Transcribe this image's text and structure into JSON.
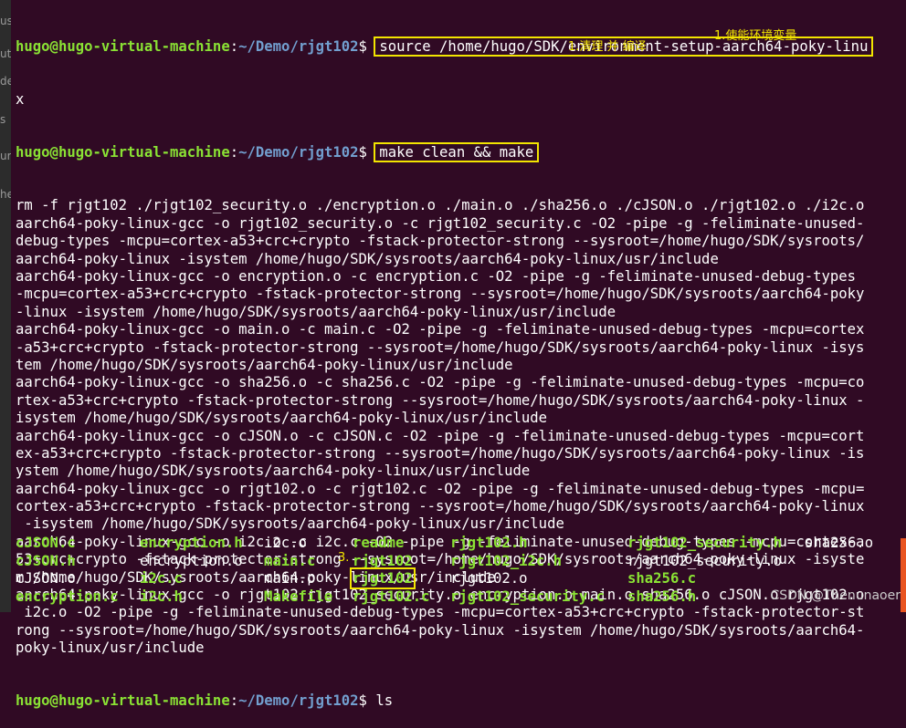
{
  "sidebar": {
    "fragments": [
      "usi",
      "ut",
      "de",
      "s",
      "ur",
      "he"
    ]
  },
  "prompt": {
    "user": "hugo@hugo-virtual-machine",
    "path": "~/Demo/rjgt102",
    "symbol": "$"
  },
  "cmd1": {
    "text": "source /home/hugo/SDK/environment-setup-aarch64-poky-linu",
    "wrap": "x"
  },
  "cmd2": {
    "text": "make clean && make"
  },
  "notes": {
    "note1": "1.使能环境变量",
    "note2": "1.清理 并 编译",
    "note3": "3."
  },
  "output": [
    "rm -f rjgt102 ./rjgt102_security.o ./encryption.o ./main.o ./sha256.o ./cJSON.o ./rjgt102.o ./i2c.o",
    "aarch64-poky-linux-gcc -o rjgt102_security.o -c rjgt102_security.c -O2 -pipe -g -feliminate-unused-",
    "debug-types -mcpu=cortex-a53+crc+crypto -fstack-protector-strong --sysroot=/home/hugo/SDK/sysroots/",
    "aarch64-poky-linux -isystem /home/hugo/SDK/sysroots/aarch64-poky-linux/usr/include",
    "aarch64-poky-linux-gcc -o encryption.o -c encryption.c -O2 -pipe -g -feliminate-unused-debug-types",
    "-mcpu=cortex-a53+crc+crypto -fstack-protector-strong --sysroot=/home/hugo/SDK/sysroots/aarch64-poky",
    "-linux -isystem /home/hugo/SDK/sysroots/aarch64-poky-linux/usr/include",
    "aarch64-poky-linux-gcc -o main.o -c main.c -O2 -pipe -g -feliminate-unused-debug-types -mcpu=cortex",
    "-a53+crc+crypto -fstack-protector-strong --sysroot=/home/hugo/SDK/sysroots/aarch64-poky-linux -isys",
    "tem /home/hugo/SDK/sysroots/aarch64-poky-linux/usr/include",
    "aarch64-poky-linux-gcc -o sha256.o -c sha256.c -O2 -pipe -g -feliminate-unused-debug-types -mcpu=co",
    "rtex-a53+crc+crypto -fstack-protector-strong --sysroot=/home/hugo/SDK/sysroots/aarch64-poky-linux -",
    "isystem /home/hugo/SDK/sysroots/aarch64-poky-linux/usr/include",
    "aarch64-poky-linux-gcc -o cJSON.o -c cJSON.c -O2 -pipe -g -feliminate-unused-debug-types -mcpu=cort",
    "ex-a53+crc+crypto -fstack-protector-strong --sysroot=/home/hugo/SDK/sysroots/aarch64-poky-linux -is",
    "ystem /home/hugo/SDK/sysroots/aarch64-poky-linux/usr/include",
    "aarch64-poky-linux-gcc -o rjgt102.o -c rjgt102.c -O2 -pipe -g -feliminate-unused-debug-types -mcpu=",
    "cortex-a53+crc+crypto -fstack-protector-strong --sysroot=/home/hugo/SDK/sysroots/aarch64-poky-linux",
    " -isystem /home/hugo/SDK/sysroots/aarch64-poky-linux/usr/include",
    "aarch64-poky-linux-gcc -o i2c.o -c i2c.c -O2 -pipe -g -feliminate-unused-debug-types -mcpu=cortex-a",
    "53+crc+crypto -fstack-protector-strong --sysroot=/home/hugo/SDK/sysroots/aarch64-poky-linux -isyste",
    "m /home/hugo/SDK/sysroots/aarch64-poky-linux/usr/include",
    "aarch64-poky-linux-gcc -o rjgt102 rjgt102_security.o encryption.o main.o sha256.o cJSON.o rjgt102.o",
    " i2c.o -O2 -pipe -g -feliminate-unused-debug-types -mcpu=cortex-a53+crc+crypto -fstack-protector-st",
    "rong --sysroot=/home/hugo/SDK/sysroots/aarch64-poky-linux -isystem /home/hugo/SDK/sysroots/aarch64-",
    "poky-linux/usr/include"
  ],
  "cmd3": {
    "text": "ls"
  },
  "ls": [
    [
      {
        "t": "cJSON.c",
        "g": true
      },
      {
        "t": "cJSON.h",
        "g": true
      },
      {
        "t": "cJSON.o",
        "g": false
      },
      {
        "t": "encryption.c",
        "g": true
      }
    ],
    [
      {
        "t": "encryption.h",
        "g": true
      },
      {
        "t": "encryption.o",
        "g": false
      },
      {
        "t": "i2c.c",
        "g": true
      },
      {
        "t": "i2c.h",
        "g": true
      }
    ],
    [
      {
        "t": "i2c.o",
        "g": false
      },
      {
        "t": "main.c",
        "g": true
      },
      {
        "t": "main.o",
        "g": false
      },
      {
        "t": "Makefile",
        "g": true
      }
    ],
    [
      {
        "t": "readme",
        "g": true
      },
      {
        "t": "rjgt102",
        "g": true
      },
      {
        "t": "rjgt102",
        "g": true
      },
      {
        "t": "rjgt102.c",
        "g": true
      }
    ],
    [
      {
        "t": "rjgt102.h",
        "g": true
      },
      {
        "t": "rjgt102_i2c.h",
        "g": true
      },
      {
        "t": "rjgt102.o",
        "g": false
      },
      {
        "t": "rjgt102_security.c",
        "g": true
      }
    ],
    [
      {
        "t": "rjgt102_security.h",
        "g": true
      },
      {
        "t": "rjgt102_security.o",
        "g": false
      },
      {
        "t": "sha256.c",
        "g": true
      },
      {
        "t": "sha256.h",
        "g": true
      }
    ],
    [
      {
        "t": "sha256.o",
        "g": false
      }
    ]
  ],
  "watermark": "CSDN @Thenunaoer",
  "colors": {
    "background": "#300a24",
    "user": "#8ae234",
    "path": "#729fcf",
    "highlight": "#f2e500"
  }
}
